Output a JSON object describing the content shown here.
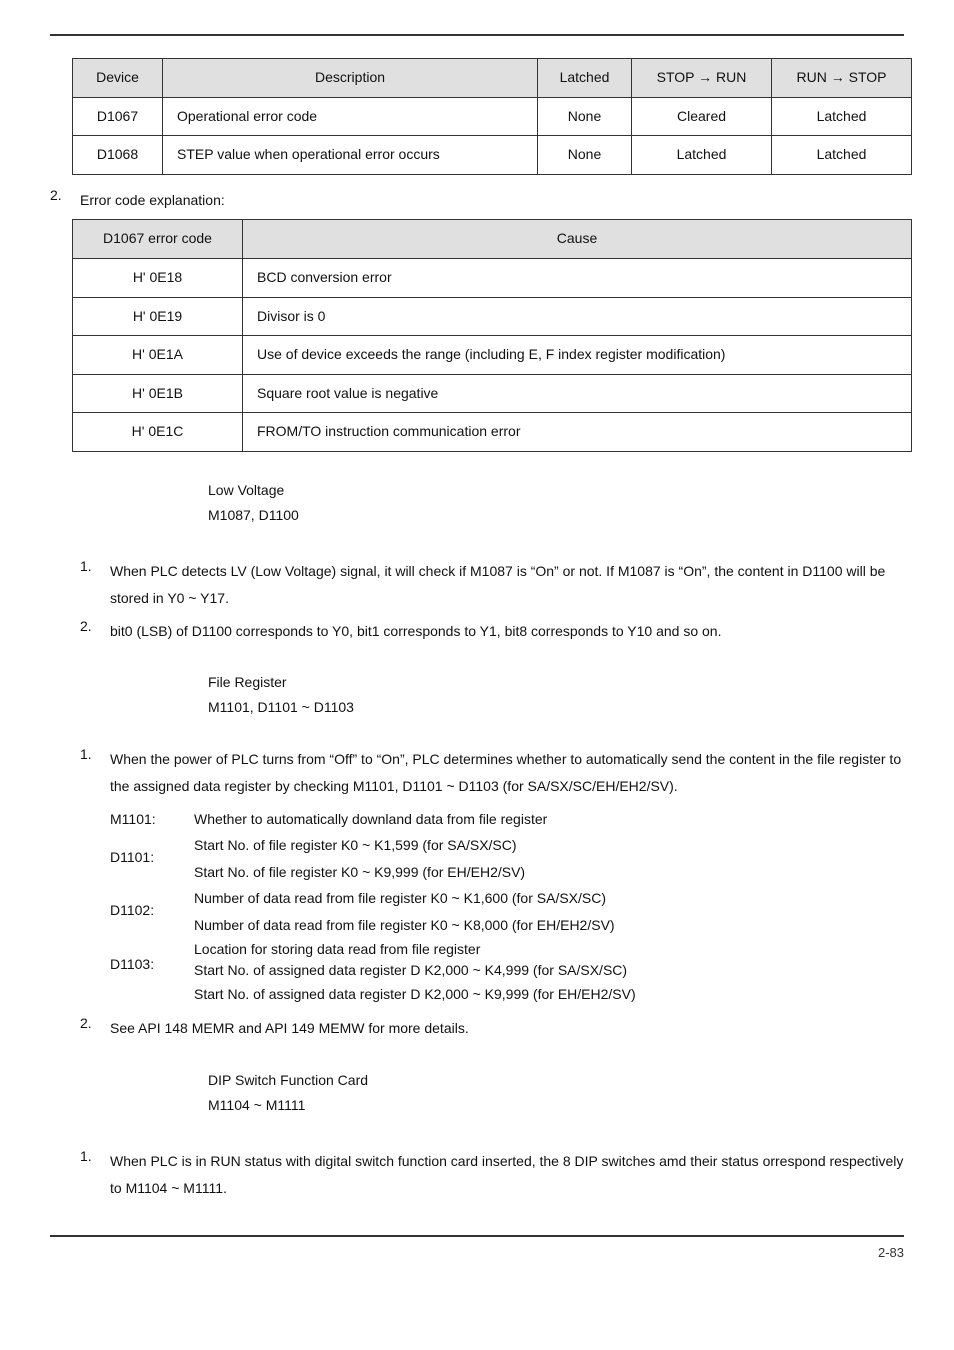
{
  "table1": {
    "headers": [
      "Device",
      "Description",
      "Latched",
      "STOP → RUN",
      "RUN → STOP"
    ],
    "rows": [
      [
        "D1067",
        "Operational error code",
        "None",
        "Cleared",
        "Latched"
      ],
      [
        "D1068",
        "STEP value when operational error occurs",
        "None",
        "Latched",
        "Latched"
      ]
    ]
  },
  "list2_lead": {
    "num": "2.",
    "text": "Error code explanation:"
  },
  "table2": {
    "headers": [
      "D1067 error code",
      "Cause"
    ],
    "rows": [
      [
        "H' 0E18",
        "BCD conversion error"
      ],
      [
        "H' 0E19",
        "Divisor is 0"
      ],
      [
        "H' 0E1A",
        "Use of device exceeds the range (including E, F index register modification)"
      ],
      [
        "H' 0E1B",
        "Square root value is negative"
      ],
      [
        "H' 0E1C",
        "FROM/TO instruction communication error"
      ]
    ]
  },
  "sec_lv": {
    "title": "Low Voltage",
    "sub": "M1087, D1100",
    "items": [
      {
        "n": "1.",
        "t": "When PLC detects LV (Low Voltage) signal, it will check if M1087 is “On” or not. If M1087 is “On”, the content in D1100 will be stored in Y0 ~ Y17."
      },
      {
        "n": "2.",
        "t": "bit0 (LSB) of D1100 corresponds to Y0, bit1 corresponds to Y1, bit8 corresponds to Y10 and so on."
      }
    ]
  },
  "sec_fr": {
    "title": "File Register",
    "sub": "M1101, D1101 ~ D1103",
    "item1": {
      "n": "1.",
      "t": "When the power of PLC turns from “Off” to “On”, PLC determines whether to automatically send the content in the file register to the assigned data register by checking M1101, D1101 ~ D1103 (for SA/SX/SC/EH/EH2/SV)."
    },
    "defs": {
      "m1101": "Whether to automatically downland data from file register",
      "d1101a": "Start No. of file register K0 ~ K1,599 (for SA/SX/SC)",
      "d1101b": "Start No. of file register K0 ~ K9,999 (for EH/EH2/SV)",
      "d1102a": "Number of data read from file register K0 ~ K1,600 (for SA/SX/SC)",
      "d1102b": "Number of data read from file register K0 ~ K8,000 (for EH/EH2/SV)",
      "d1103a": "Location for storing data read from file register",
      "d1103b": "Start No. of assigned data register D K2,000 ~ K4,999 (for SA/SX/SC)",
      "d1103c": "Start No. of assigned data register D K2,000 ~ K9,999 (for EH/EH2/SV)"
    },
    "labels": {
      "m1101": "M1101:",
      "d1101": "D1101:",
      "d1102": "D1102:",
      "d1103": "D1103:"
    },
    "item2": {
      "n": "2.",
      "t": "See API 148 MEMR and API 149 MEMW for more details."
    }
  },
  "sec_dip": {
    "title": "DIP Switch Function Card",
    "sub": "M1104 ~ M1111",
    "item1": {
      "n": "1.",
      "t": "When PLC is in RUN status with digital switch function card inserted, the 8 DIP switches amd their status orrespond respectively to M1104 ~ M1111."
    }
  },
  "footer": "2-83"
}
